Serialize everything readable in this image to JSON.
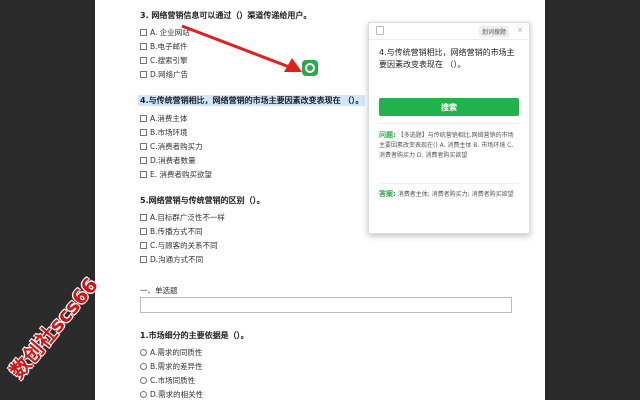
{
  "questions": {
    "q3": {
      "title": "3.  网络营销信息可以通过（）渠道传递给用户。",
      "options": [
        "A.  企业网站",
        "B.电子邮件",
        "C.搜索引擎",
        "D.网络广告"
      ]
    },
    "q4": {
      "title": "4.与传统营销相比，网络营销的市场主要因素改变表现在  （）。",
      "options": [
        "A.消费主体",
        "B.市场环境",
        "C.消费者购买力",
        "D.消费者数量",
        "E. 消费者购买欲望"
      ]
    },
    "q5": {
      "title": "5.网络营销与传统营销的区别（）。",
      "options": [
        "A.目标群广泛性不一样",
        "B.传播方式不同",
        "C.与顾客的关系不同",
        "D.沟通方式不同"
      ]
    },
    "section": "一、单选题",
    "q1": {
      "title": "1.市场细分的主要依据是（）。",
      "options": [
        "A.需求的同质性",
        "B.需求的差异性",
        "C.市场同质性",
        "D.需求的相关性"
      ]
    }
  },
  "panel": {
    "mode_label": "划词搜题",
    "close": "×",
    "question_text": "4.与传统营销相比，网络营销的市场主要因素改变表现在  （）。",
    "search_label": "搜索",
    "result_q_label": "问题:",
    "result_q_text": "【多选题】与传统营销相比,网络营销的市场主要因素改变表现在() A. 消费主体 B. 市场环境 C. 消费者购买力 D. 消费者购买欲望",
    "result_a_label": "答案:",
    "result_a_text": "消费者主体; 消费者购买力; 消费者购买欲望"
  },
  "watermark": "数创社scs66",
  "colors": {
    "accent_green": "#22b24c",
    "highlight": "#cfe6ff",
    "arrow_red": "#e02020",
    "watermark": "#d41414"
  }
}
